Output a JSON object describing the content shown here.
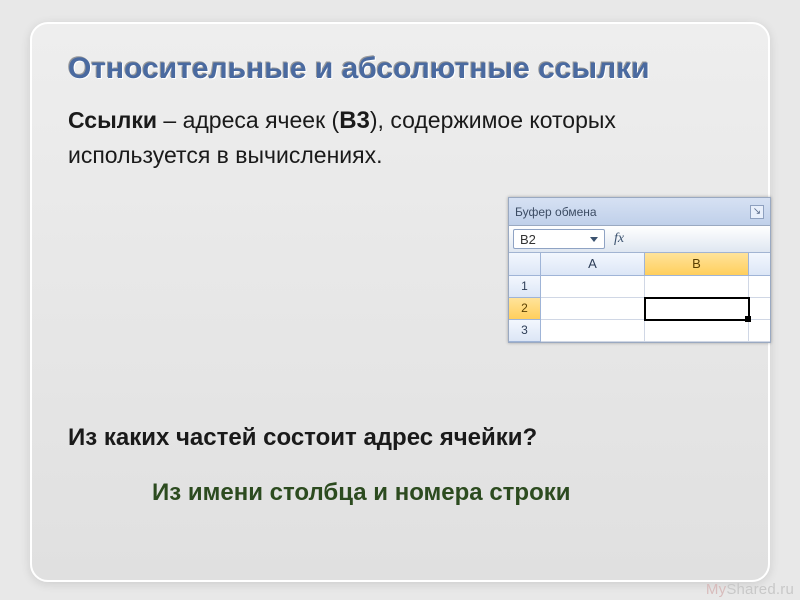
{
  "title": "Относительные и абсолютные ссылки",
  "body": {
    "lead": "Ссылки",
    "t1": " – адреса ячеек (",
    "b3": "В3",
    "t2": "), содержимое которых используется в вычислениях."
  },
  "question": "Из каких частей состоит адрес ячейки?",
  "answer": "Из имени столбца и номера строки",
  "excel": {
    "ribbon_group": "Буфер обмена",
    "namebox": "B2",
    "fx": "fx",
    "cols": [
      "A",
      "B"
    ],
    "rows": [
      "1",
      "2",
      "3"
    ],
    "active_cell": "B2"
  },
  "watermark": {
    "my": "My",
    "rest": "Shared.ru"
  }
}
